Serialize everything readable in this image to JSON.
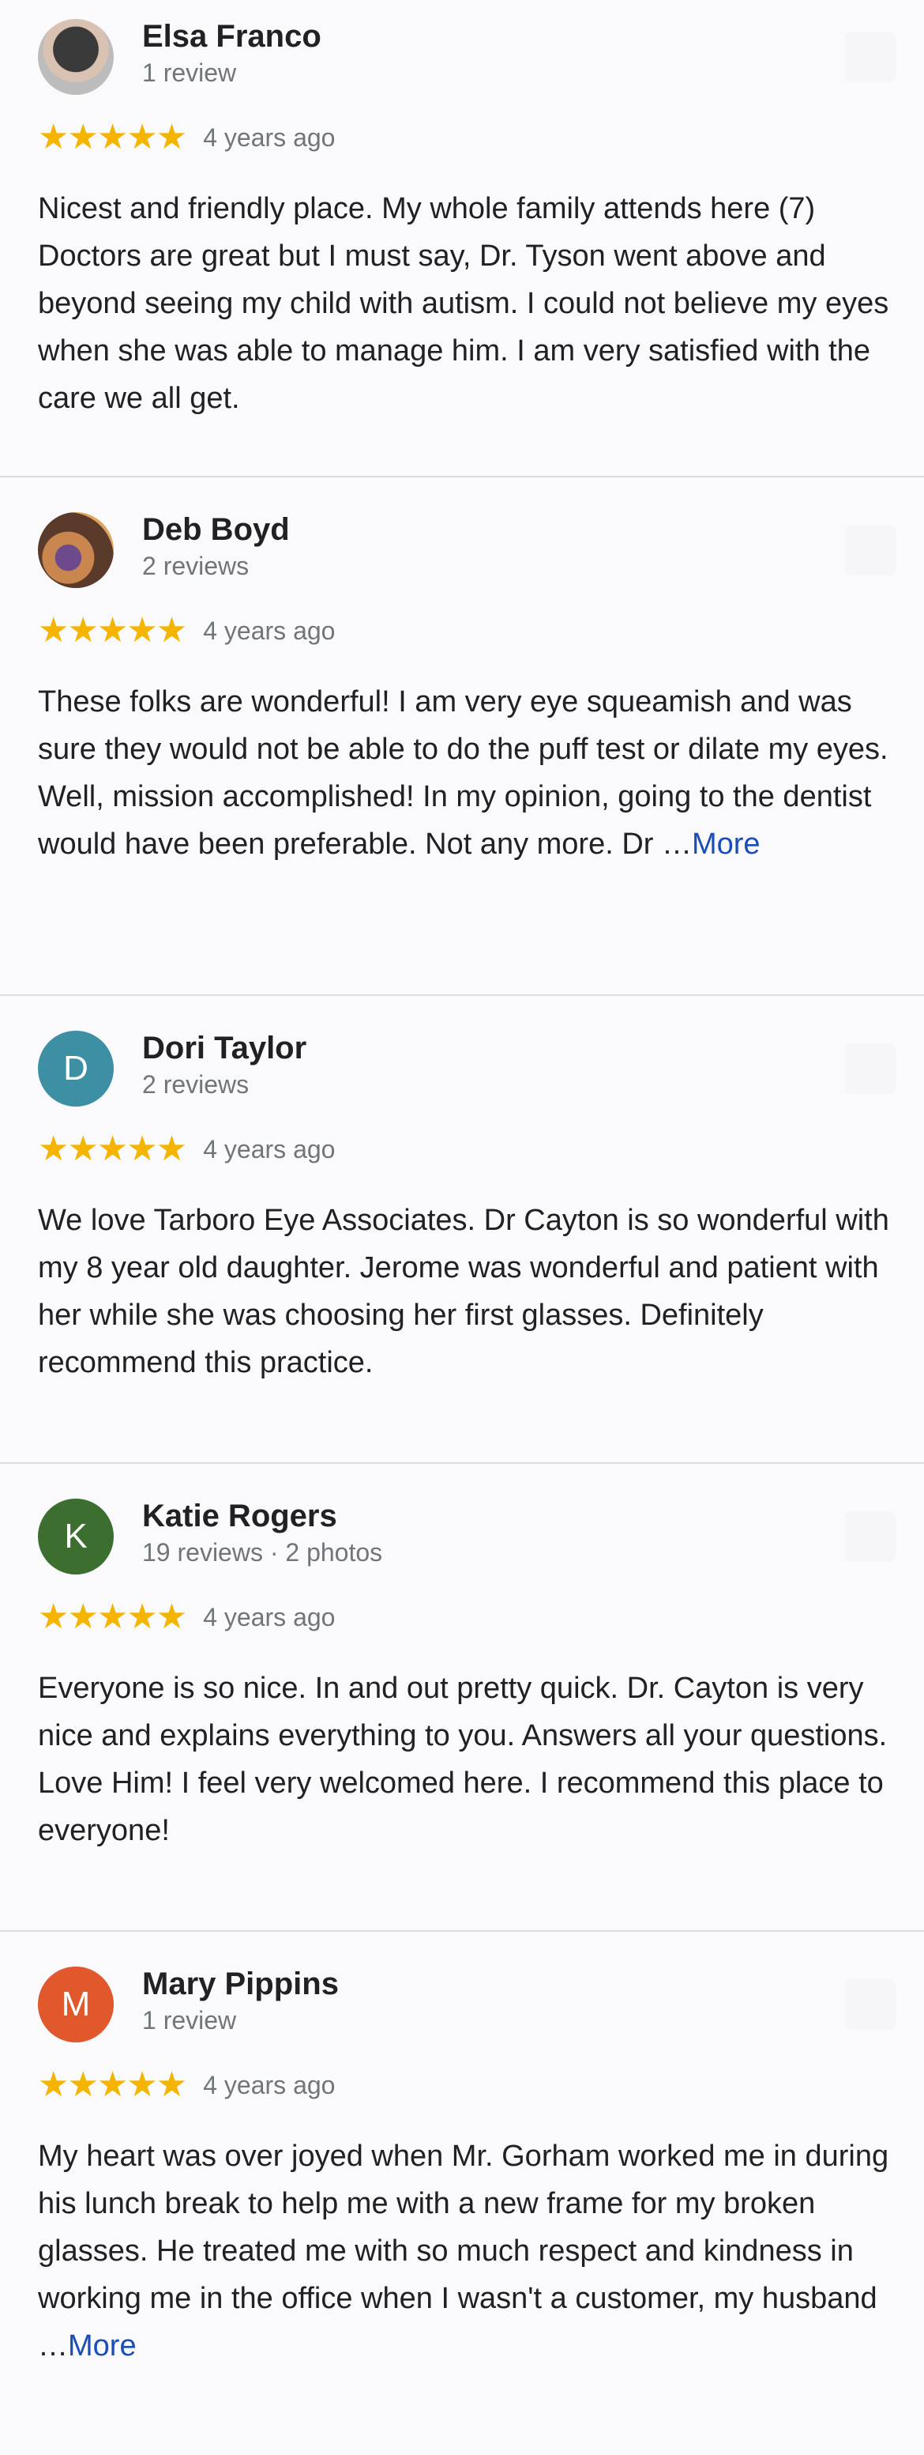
{
  "reviews": [
    {
      "name": "Elsa Franco",
      "meta": "1 review",
      "stars": "★★★★★",
      "date": "4 years ago",
      "text": "Nicest and friendly place. My whole family attends here (7) Doctors are great but I must say, Dr. Tyson went above and beyond seeing my child with autism. I could not believe my eyes when she was able to manage him. I am very satisfied with the care we all get.",
      "more": ""
    },
    {
      "name": "Deb Boyd",
      "meta": "2 reviews",
      "stars": "★★★★★",
      "date": "4 years ago",
      "text": "These folks are wonderful! I am very eye squeamish and was sure they would not be able to do the puff test or dilate my eyes. Well, mission accomplished! In my opinion, going to the dentist would have been preferable. Not any more. Dr …",
      "more": "More"
    },
    {
      "name": "Dori Taylor",
      "avatar_letter": "D",
      "avatar_color": "#3d8fa3",
      "meta": "2 reviews",
      "stars": "★★★★★",
      "date": "4 years ago",
      "text": "We love Tarboro Eye Associates. Dr Cayton is so wonderful with my 8 year old daughter. Jerome was wonderful and patient with her while she was choosing her first glasses. Definitely recommend this practice.",
      "more": ""
    },
    {
      "name": "Katie Rogers",
      "avatar_letter": "K",
      "avatar_color": "#3c6e2f",
      "meta": "19 reviews · 2 photos",
      "stars": "★★★★★",
      "date": "4 years ago",
      "text": "Everyone is so nice. In and out pretty quick. Dr. Cayton is very nice and explains everything to you. Answers all your questions. Love Him! I feel very welcomed here. I recommend this place to everyone!",
      "more": ""
    },
    {
      "name": "Mary Pippins",
      "avatar_letter": "M",
      "avatar_color": "#e2582d",
      "meta": "1 review",
      "stars": "★★★★★",
      "date": "4 years ago",
      "text": "My heart was over joyed when Mr. Gorham worked me in during his lunch break to help me with a new frame for my broken glasses. He treated me with so much respect and kindness in working me in the office when I wasn't a customer, my husband …",
      "more": "More"
    }
  ],
  "colors": {
    "star": "#f4b400",
    "link": "#1a4db8",
    "muted": "#70757a",
    "divider": "#dadce0"
  }
}
